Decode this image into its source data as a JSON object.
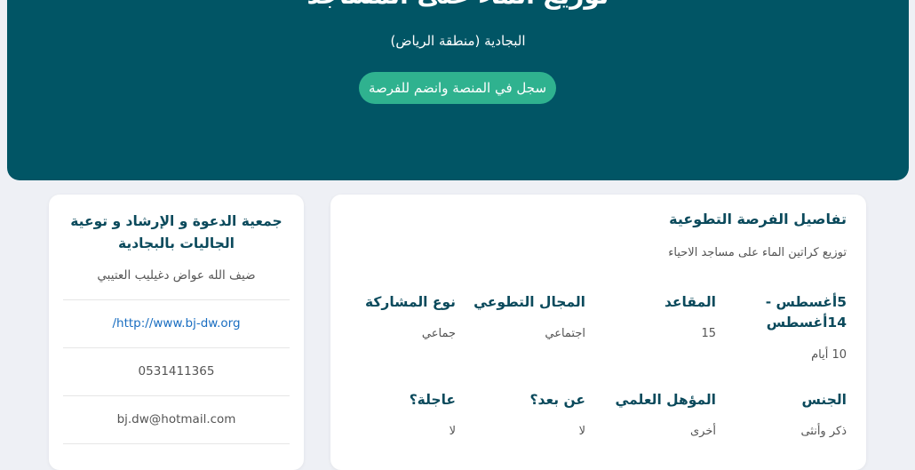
{
  "hero": {
    "title": "توزيع الماء على المساجد",
    "location": "البجادية (منطقة الرياض)",
    "register_button": "سجل في المنصة وانضم للفرصة",
    "background_color": "#015565",
    "button_color": "#2fb28f"
  },
  "organization": {
    "name": "جمعية الدعوة و الإرشاد و توعية الجاليات بالبجادية",
    "contact_person": "ضيف الله عواض دغيليب العتيبي",
    "website": "/http://www.bj-dw.org",
    "phone": "0531411365",
    "email": "bj.dw@hotmail.com"
  },
  "details": {
    "title": "تفاصيل الفرصة التطوعية",
    "description": "توزيع كراتين الماء على مساجد الاحياء",
    "fields": [
      {
        "label": "5أغسطس  -  14أغسطس",
        "value": "10 أيام"
      },
      {
        "label": "المقاعد",
        "value": "15"
      },
      {
        "label": "المجال التطوعي",
        "value": "اجتماعي"
      },
      {
        "label": "نوع المشاركة",
        "value": "جماعي"
      },
      {
        "label": "الجنس",
        "value": "ذكر وأنثى"
      },
      {
        "label": "المؤهل العلمي",
        "value": "أخرى"
      },
      {
        "label": "عن بعد؟",
        "value": "لا"
      },
      {
        "label": "عاجلة؟",
        "value": "لا"
      }
    ]
  }
}
